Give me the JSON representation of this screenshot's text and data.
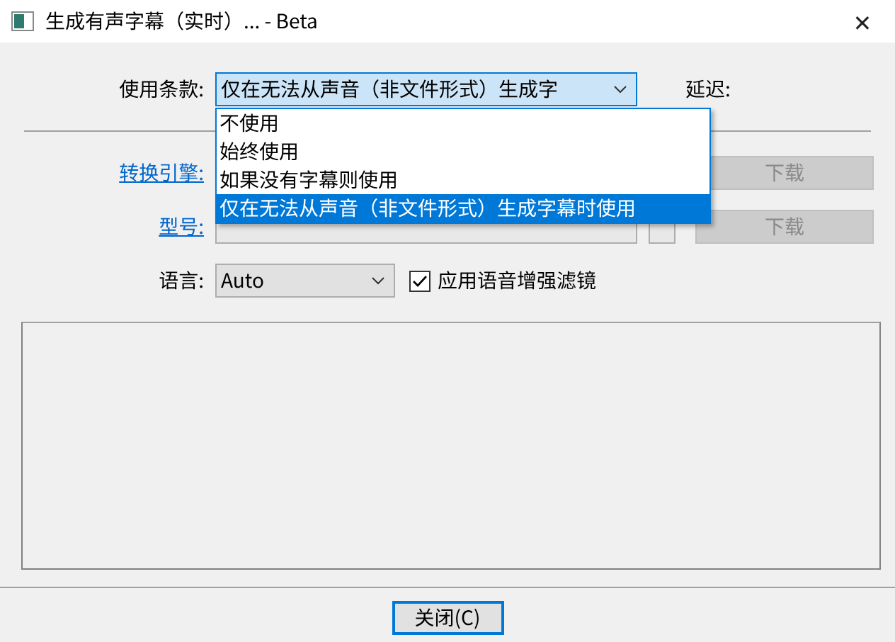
{
  "window": {
    "title": "生成有声字幕（实时）... - Beta",
    "close": "✕"
  },
  "usage": {
    "label": "使用条款:",
    "value": "仅在无法从声音（非文件形式）生成字",
    "expanded": true,
    "options": [
      {
        "label": "不使用",
        "selected": false
      },
      {
        "label": "始终使用",
        "selected": false
      },
      {
        "label": "如果没有字幕则使用",
        "selected": false
      },
      {
        "label": "仅在无法从声音（非文件形式）生成字幕时使用",
        "selected": true
      }
    ]
  },
  "delay": {
    "label": "延迟:"
  },
  "engine": {
    "label": "转换引擎:",
    "button": "下载",
    "disabled": true
  },
  "model": {
    "label": "型号:",
    "button": "下载",
    "disabled": true
  },
  "language": {
    "label": "语言:",
    "value": "Auto",
    "filter": {
      "label": "应用语音增强滤镜",
      "checked": true
    }
  },
  "close_button": "关闭(C)"
}
